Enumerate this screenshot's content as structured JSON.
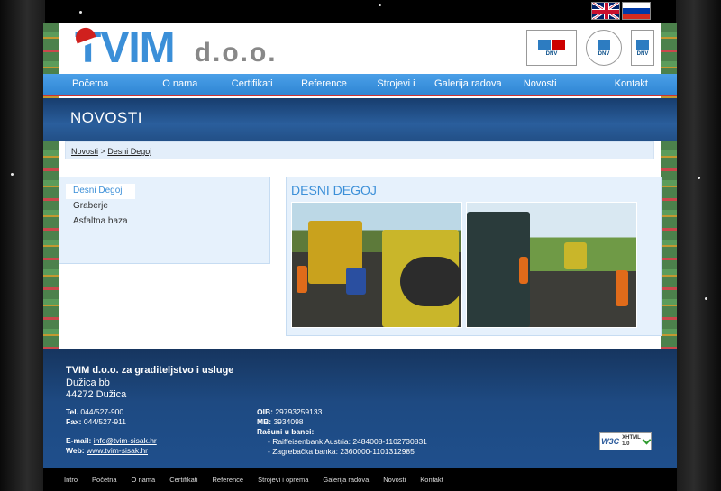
{
  "languages": [
    {
      "code": "en",
      "label": "English"
    },
    {
      "code": "ru",
      "label": "Russian"
    }
  ],
  "brand": {
    "name": "TVIM",
    "suffix": "d.o.o."
  },
  "nav": {
    "items": [
      "Početna",
      "O nama",
      "Certifikati",
      "Reference",
      "Strojevi i oprema",
      "Galerija radova",
      "Novosti",
      "Kontakt"
    ]
  },
  "banner": {
    "title": "NOVOSTI"
  },
  "breadcrumb": {
    "parent": "Novosti",
    "separator": " > ",
    "current": "Desni Degoj"
  },
  "sidebar": {
    "items": [
      "Desni Degoj",
      "Graberje",
      "Asfaltna baza"
    ],
    "active_index": 0
  },
  "content": {
    "title": "DESNI DEGOJ"
  },
  "footer": {
    "company": "TVIM d.o.o. za graditeljstvo i usluge",
    "address_line1": "Dužica bb",
    "address_line2": "44272 Dužica",
    "tel_label": "Tel.",
    "tel": "044/527-900",
    "fax_label": "Fax:",
    "fax": "044/527-911",
    "email_label": "E-mail:",
    "email": "info@tvim-sisak.hr",
    "web_label": "Web:",
    "web": "www.tvim-sisak.hr",
    "oib_label": "OIB:",
    "oib": "29793259133",
    "mb_label": "MB:",
    "mb": "3934098",
    "bank_label": "Računi u banci:",
    "bank1": "- Raiffeisenbank Austria: 2484008-1102730831",
    "bank2": "- Zagrebačka banka: 2360000-1101312985",
    "w3c_text": "W3C",
    "xhtml_text": "XHTML",
    "xhtml_version": "1.0"
  },
  "bottom_nav": {
    "items": [
      "Intro",
      "Početna",
      "O nama",
      "Certifikati",
      "Reference",
      "Strojevi i oprema",
      "Galerija radova",
      "Novosti",
      "Kontakt"
    ]
  }
}
